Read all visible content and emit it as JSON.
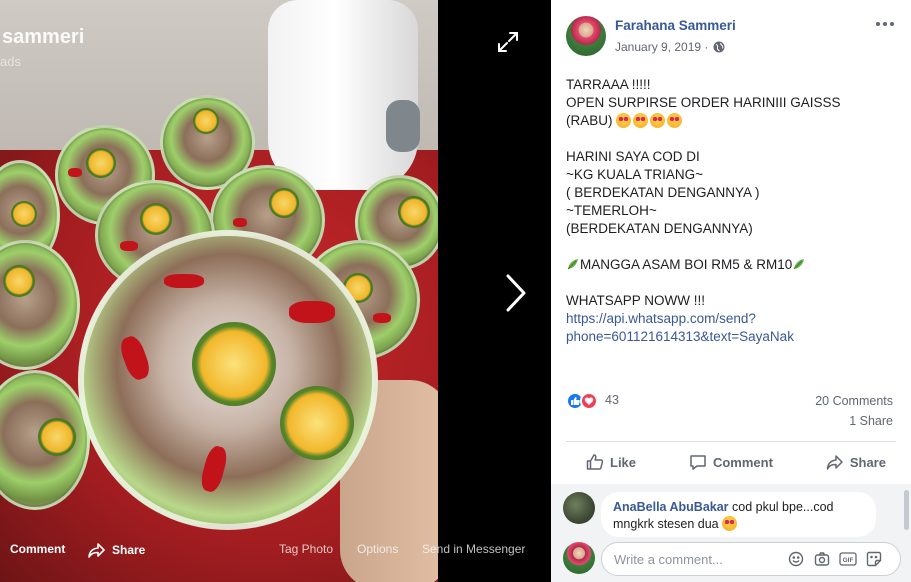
{
  "viewer": {
    "overlay_name": "sammeri",
    "overlay_sub": "ads",
    "bottom": {
      "comment_label": "Comment",
      "share_label": "Share",
      "tag_photo_label": "Tag Photo",
      "options_label": "Options",
      "send_label": "Send in Messenger"
    }
  },
  "post": {
    "author": "Farahana Sammeri",
    "date": "January 9, 2019 ·",
    "text_lines": {
      "l1": "TARRAAA !!!!!",
      "l2": "OPEN SURPIRSE ORDER HARINIII GAISSS",
      "l3": "(RABU)",
      "l5": "HARINI SAYA COD DI",
      "l6": "~KG KUALA TRIANG~",
      "l7": "( BERDEKATAN DENGANNYA )",
      "l8": "~TEMERLOH~",
      "l9": "(BERDEKATAN DENGANNYA)",
      "l11": "MANGGA ASAM BOI RM5 & RM10",
      "l13": "WHATSAPP NOWW !!!",
      "link1": "https://api.whatsapp.com/send?",
      "link2": "phone=601121614313&text=SayaNak"
    },
    "reaction_count": "43",
    "comments_count": "20 Comments",
    "shares_count": "1 Share"
  },
  "actions": {
    "like": "Like",
    "comment": "Comment",
    "share": "Share"
  },
  "comment": {
    "author": "AnaBella AbuBakar",
    "text1": " cod pkul bpe...cod",
    "text2": "mngkrk stesen dua"
  },
  "write_comment": {
    "placeholder": "Write a comment..."
  }
}
